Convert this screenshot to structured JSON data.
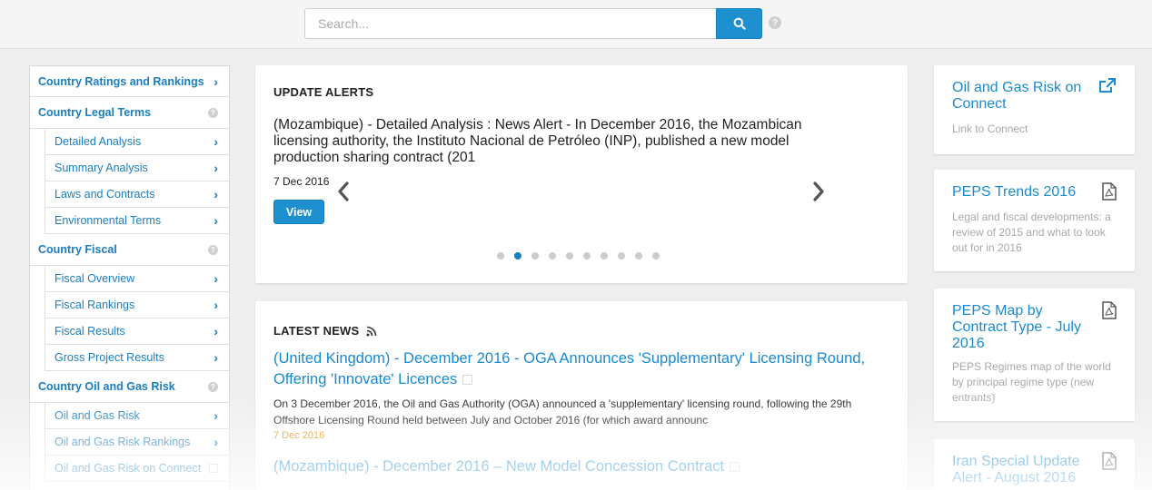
{
  "search": {
    "placeholder": "Search...",
    "help": "?"
  },
  "sidebar": {
    "items": [
      {
        "label": "Country Ratings and Rankings",
        "level": "top",
        "icon": "chevron-right-icon"
      },
      {
        "label": "Country Legal Terms",
        "level": "top",
        "icon": "help-icon"
      },
      {
        "label": "Detailed Analysis",
        "level": "sub",
        "icon": "chevron-right-icon"
      },
      {
        "label": "Summary Analysis",
        "level": "sub",
        "icon": "chevron-right-icon"
      },
      {
        "label": "Laws and Contracts",
        "level": "sub",
        "icon": "chevron-right-icon"
      },
      {
        "label": "Environmental Terms",
        "level": "sub",
        "icon": "chevron-right-icon"
      },
      {
        "label": "Country Fiscal",
        "level": "top",
        "icon": "help-icon"
      },
      {
        "label": "Fiscal Overview",
        "level": "sub",
        "icon": "chevron-right-icon"
      },
      {
        "label": "Fiscal Rankings",
        "level": "sub",
        "icon": "chevron-right-icon"
      },
      {
        "label": "Fiscal Results",
        "level": "sub",
        "icon": "chevron-right-icon"
      },
      {
        "label": "Gross Project Results",
        "level": "sub",
        "icon": "chevron-right-icon"
      },
      {
        "label": "Country Oil and Gas Risk",
        "level": "top",
        "icon": "help-icon"
      },
      {
        "label": "Oil and Gas Risk",
        "level": "sub",
        "icon": "chevron-right-icon"
      },
      {
        "label": "Oil and Gas Risk Rankings",
        "level": "sub",
        "icon": "chevron-right-icon"
      },
      {
        "label": "Oil and Gas Risk on Connect",
        "level": "sub",
        "icon": "external-link-icon"
      }
    ]
  },
  "alerts": {
    "title": "UPDATE ALERTS",
    "text": "(Mozambique) - Detailed Analysis : News Alert - In December 2016, the Mozambican licensing authority, the Instituto Nacional de Petróleo (INP), published a new model production sharing contract (201",
    "date": "7 Dec 2016",
    "view_label": "View",
    "dot_count": 10,
    "active_dot": 2
  },
  "news": {
    "title": "LATEST NEWS",
    "items": [
      {
        "headline": "(United Kingdom) - December 2016 - OGA Announces 'Supplementary' Licensing Round, Offering 'Innovate' Licences",
        "summary": "On 3 December 2016, the Oil and Gas Authority (OGA) announced a 'supplementary' licensing round, following the 29th Offshore Licensing Round held between July and October 2016 (for which award announc",
        "date": "7 Dec 2016"
      },
      {
        "headline": "(Mozambique) - December 2016 – New Model Concession Contract"
      }
    ]
  },
  "right_cards": [
    {
      "title": "Oil and Gas Risk on Connect",
      "desc": "Link to Connect",
      "icon": "external-link-icon"
    },
    {
      "title": "PEPS Trends 2016",
      "desc": "Legal and fiscal developments: a review of 2015 and what to look out for in 2016",
      "icon": "pdf-icon"
    },
    {
      "title": "PEPS Map by Contract Type - July 2016",
      "desc": "PEPS Regimes map of the world by principal regime type (new entrants)",
      "icon": "pdf-icon"
    },
    {
      "title": "Iran Special Update Alert - August 2016",
      "desc": "",
      "icon": "pdf-icon"
    }
  ],
  "colors": {
    "accent": "#1e90d0",
    "link": "#1a8ad0",
    "date": "#e08a00"
  }
}
